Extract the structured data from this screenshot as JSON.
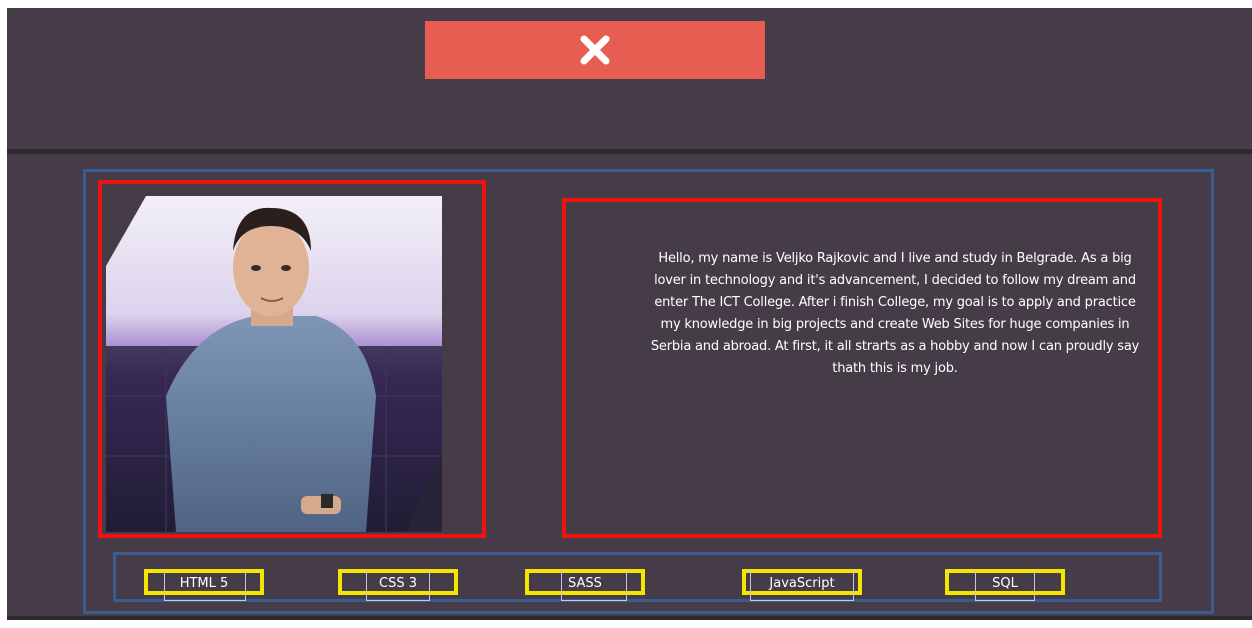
{
  "header": {
    "close_icon": "close-x-icon",
    "close_color": "#e85d52"
  },
  "about": {
    "photo_alt": "Portrait of Veljko Rajkovic",
    "bio": "Hello, my name is Veljko Rajkovic and I live and study in Belgrade. As a big lover in technology and it's advancement, I decided to follow my dream and enter The ICT College. After i finish College, my goal is to apply and practice my knowledge in big projects and create Web Sites for huge companies in Serbia and abroad. At first, it all strarts as a hobby and now I can proudly say thath this is my job."
  },
  "skills": [
    {
      "label": "HTML 5"
    },
    {
      "label": "CSS 3"
    },
    {
      "label": "SASS"
    },
    {
      "label": "JavaScript"
    },
    {
      "label": "SQL"
    }
  ],
  "colors": {
    "background": "#453c48",
    "highlight_red": "#f01212",
    "highlight_yellow": "#f4e600",
    "container_blue": "#3a5d8f"
  }
}
